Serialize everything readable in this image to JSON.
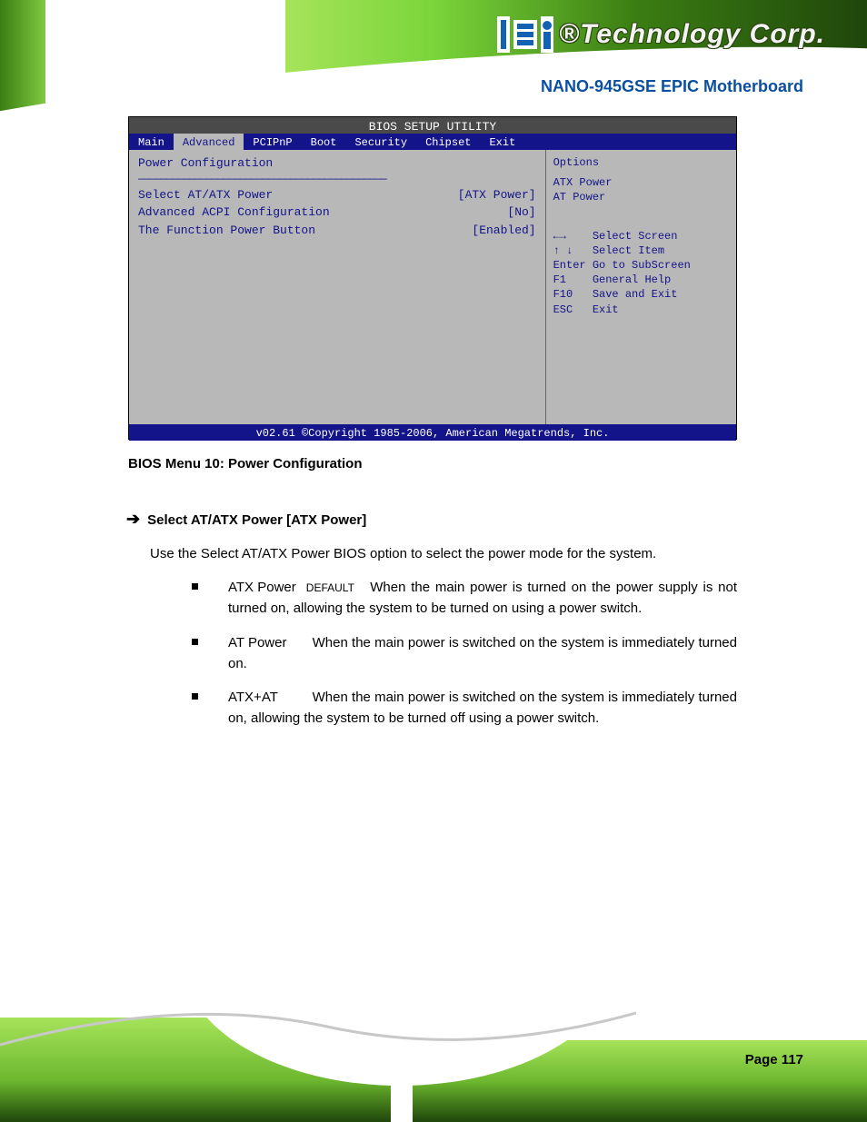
{
  "logo": {
    "reg_mark": "®",
    "company": "Technology Corp."
  },
  "doc_title": "NANO-945GSE EPIC Motherboard",
  "bios": {
    "header": "BIOS SETUP UTILITY",
    "tabs": [
      "Main",
      "Advanced",
      "PCIPnP",
      "Boot",
      "Security",
      "Chipset",
      "Exit"
    ],
    "active_tab_index": 1,
    "section_title": "Power Configuration",
    "rows": [
      {
        "label": "Select AT/ATX Power",
        "value": "[ATX Power]"
      },
      {
        "label": "Advanced ACPI Configuration",
        "value": "[No]"
      },
      {
        "label": "The Function Power Button",
        "value": "[Enabled]"
      }
    ],
    "help": "Options",
    "help_items": [
      "ATX Power",
      "AT Power"
    ],
    "nav": {
      "rows": [
        {
          "keys": "←→",
          "desc": "Select Screen"
        },
        {
          "keys": "↑ ↓",
          "desc": "Select Item"
        },
        {
          "keys": "Enter",
          "desc": "Go to SubScreen"
        },
        {
          "keys": "F1",
          "desc": "General Help"
        },
        {
          "keys": "F10",
          "desc": "Save and Exit"
        },
        {
          "keys": "ESC",
          "desc": "Exit"
        }
      ]
    },
    "footer": "v02.61 ©Copyright 1985-2006, American Megatrends, Inc."
  },
  "figure_caption": "BIOS Menu 10: Power Configuration",
  "section": {
    "arrow": "➔",
    "title": "Select AT/ATX Power [ATX Power]",
    "para": "Use the Select AT/ATX Power BIOS option to select the power mode for the system.",
    "options": [
      {
        "name": "ATX Power",
        "is_default": true,
        "default_label": "DEFAULT",
        "desc": "When the main power is turned on the power supply is not turned on, allowing the system to be turned on using a power switch."
      },
      {
        "name": "AT Power",
        "is_default": false,
        "desc": "When the main power is switched on the system is immediately turned on."
      },
      {
        "name": "ATX+AT",
        "is_default": false,
        "desc": "When the main power is switched on the system is immediately turned on, allowing the system to be turned off using a power switch."
      }
    ]
  },
  "page_number": "Page 117"
}
